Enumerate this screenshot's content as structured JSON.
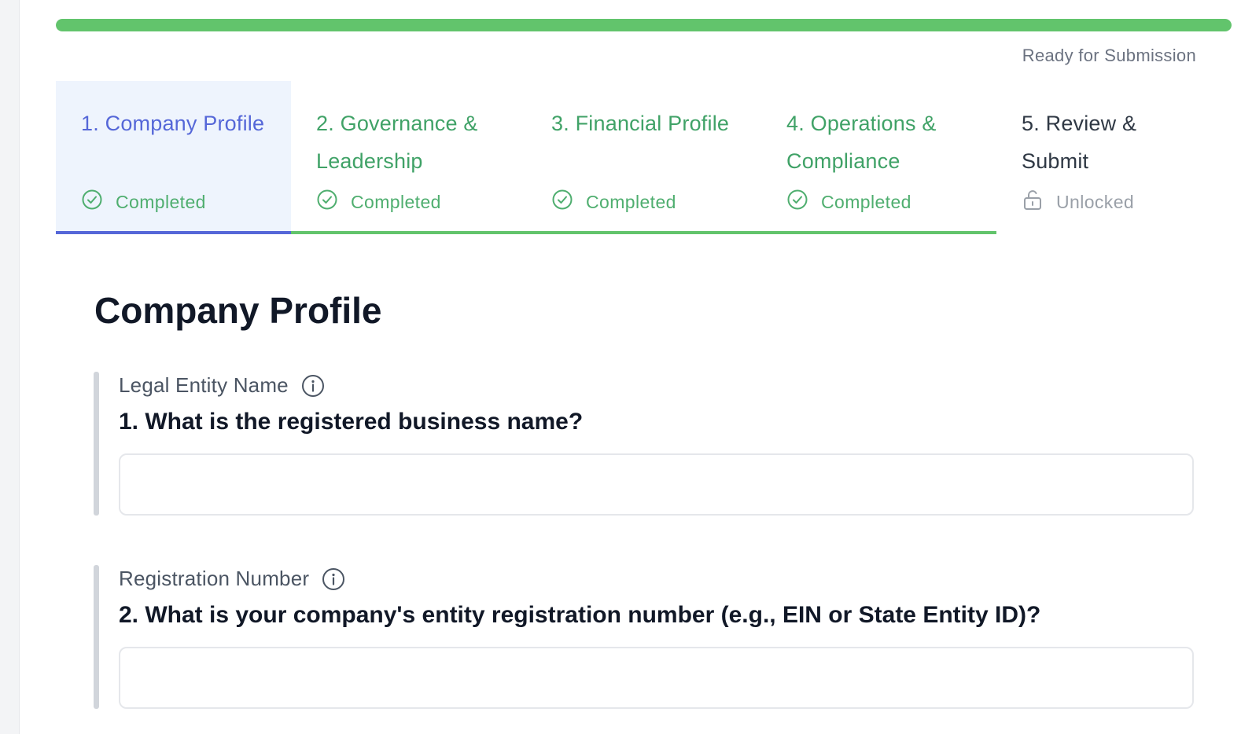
{
  "progress": {
    "value": 1.0,
    "color": "#62c46c",
    "status_text": "Ready for Submission"
  },
  "tabs": [
    {
      "label": "1. Company Profile",
      "status": "Completed",
      "status_icon": "check-circle-icon",
      "state": "active"
    },
    {
      "label": "2. Governance & Leadership",
      "status": "Completed",
      "status_icon": "check-circle-icon",
      "state": "done"
    },
    {
      "label": "3. Financial Profile",
      "status": "Completed",
      "status_icon": "check-circle-icon",
      "state": "done"
    },
    {
      "label": "4. Operations & Compliance",
      "status": "Completed",
      "status_icon": "check-circle-icon",
      "state": "done"
    },
    {
      "label": "5. Review & Submit",
      "status": "Unlocked",
      "status_icon": "unlock-icon",
      "state": "open"
    }
  ],
  "colors": {
    "accent_blue": "#5567d8",
    "success_green": "#40a267",
    "active_tab_bg": "#eef4fd"
  },
  "section": {
    "title": "Company Profile",
    "questions": [
      {
        "label": "Legal Entity Name",
        "text": "1. What is the registered business name?",
        "value": "",
        "placeholder": ""
      },
      {
        "label": "Registration Number",
        "text": "2. What is your company's entity registration number (e.g., EIN or State Entity ID)?",
        "value": "",
        "placeholder": ""
      }
    ]
  }
}
